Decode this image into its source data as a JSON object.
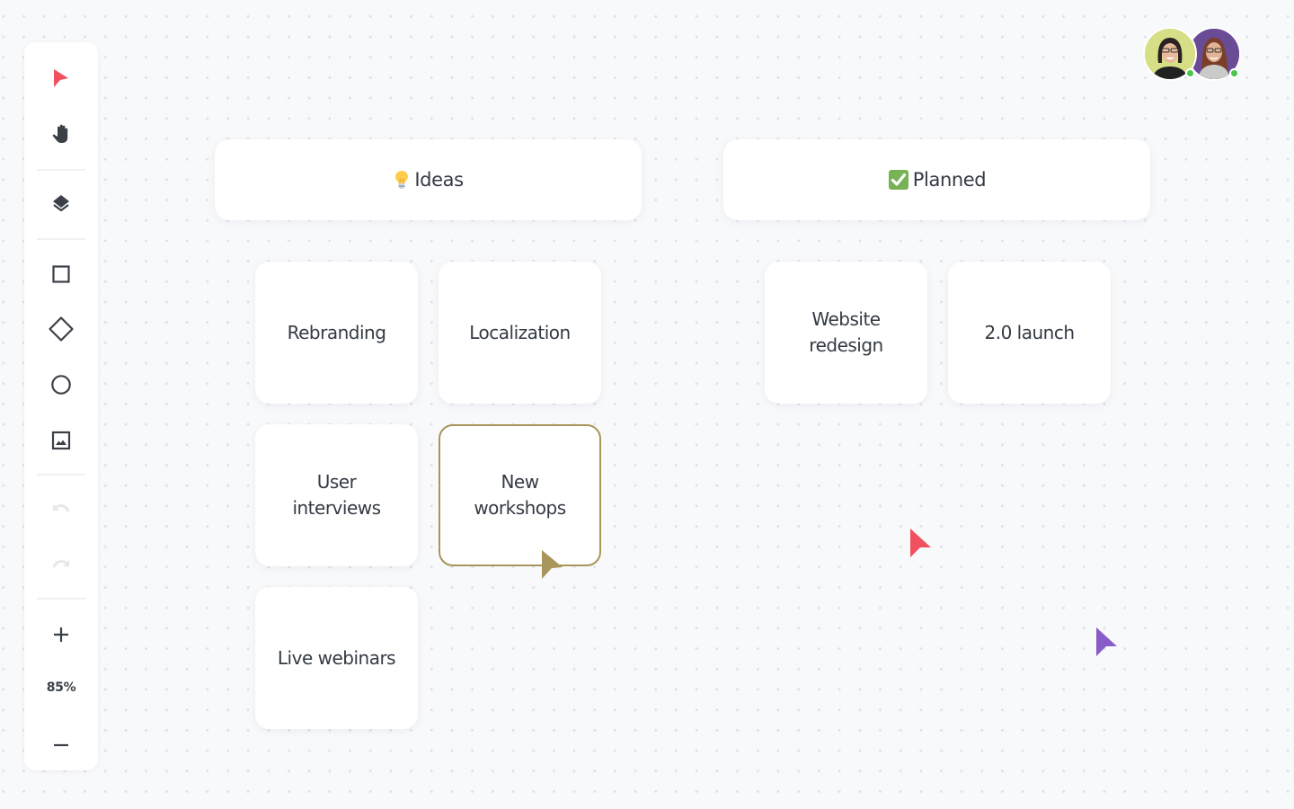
{
  "toolbar": {
    "tools": [
      {
        "name": "select",
        "icon": "pointer-arrow-icon",
        "active": true
      },
      {
        "name": "hand",
        "icon": "hand-icon"
      },
      {
        "name": "layers",
        "icon": "layers-icon"
      },
      {
        "name": "rectangle",
        "icon": "square-icon"
      },
      {
        "name": "diamond",
        "icon": "diamond-icon"
      },
      {
        "name": "ellipse",
        "icon": "circle-icon"
      },
      {
        "name": "image",
        "icon": "image-icon"
      },
      {
        "name": "undo",
        "icon": "undo-icon",
        "disabled": true
      },
      {
        "name": "redo",
        "icon": "redo-icon",
        "disabled": true
      },
      {
        "name": "zoom-in",
        "icon": "plus-icon"
      },
      {
        "name": "zoom-out",
        "icon": "minus-icon"
      }
    ],
    "zoom_level": "85%",
    "active_color": "#f0505f"
  },
  "collaborators": [
    {
      "name": "Collaborator 1",
      "background": "#d6df86",
      "status": "online"
    },
    {
      "name": "Collaborator 2",
      "background": "#6a4b96",
      "status": "online"
    }
  ],
  "columns": [
    {
      "title": "Ideas",
      "emoji": "light-bulb-icon",
      "cards": [
        "Rebranding",
        "Localization",
        "User interviews",
        "New workshops",
        "Live webinars"
      ]
    },
    {
      "title": "Planned",
      "emoji": "check-mark-button-icon",
      "cards": [
        "Website redesign",
        "2.0 launch"
      ]
    }
  ],
  "selected_card": "New workshops",
  "selection_color": "#a8955a",
  "cursors": [
    {
      "owner": "Collaborator (olive)",
      "color": "#a8955a"
    },
    {
      "owner": "Collaborator (red)",
      "color": "#f0505f"
    },
    {
      "owner": "Collaborator (purple)",
      "color": "#8a5cc8"
    }
  ]
}
